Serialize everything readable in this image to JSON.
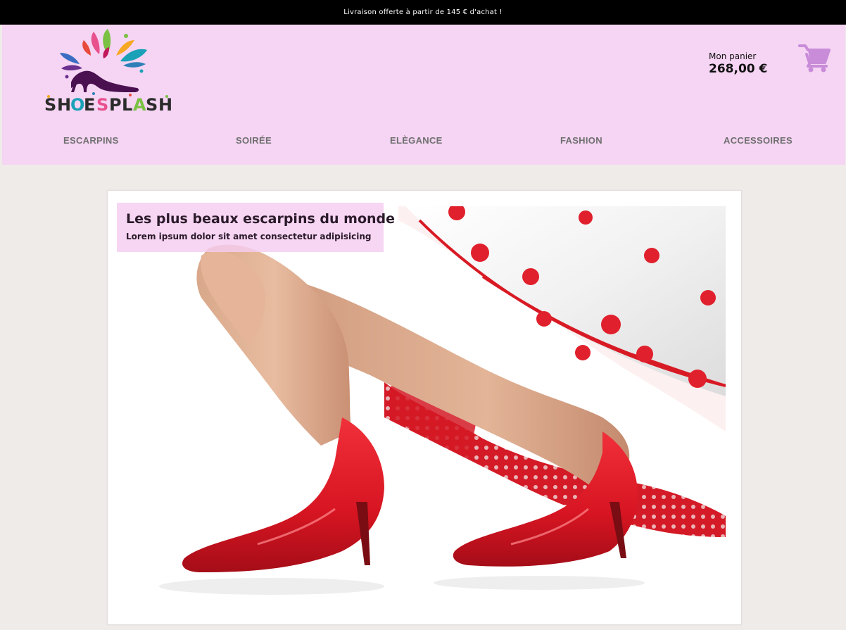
{
  "promo": {
    "text": "Livraison offerte à partir de 145 € d'achat !"
  },
  "header": {
    "logo_text": "SHOESPLASH",
    "cart": {
      "label": "Mon panier",
      "total": "268,00 €",
      "icon": "shopping-cart-icon",
      "icon_color": "#c98cd9"
    }
  },
  "nav": {
    "items": [
      {
        "label": "ESCARPINS"
      },
      {
        "label": "SOIRÉE"
      },
      {
        "label": "ELÈGANCE"
      },
      {
        "label": "FASHION"
      },
      {
        "label": "ACCESSOIRES"
      }
    ]
  },
  "hero": {
    "title": "Les plus beaux escarpins du monde",
    "subtitle": "Lorem ipsum dolor sit amet consectetur adipisicing"
  },
  "colors": {
    "promo_bg": "#000000",
    "header_bg": "#f5d5f3",
    "page_bg": "#efebe9",
    "nav_text": "#6f6f6f",
    "accent": "#c98cd9"
  }
}
